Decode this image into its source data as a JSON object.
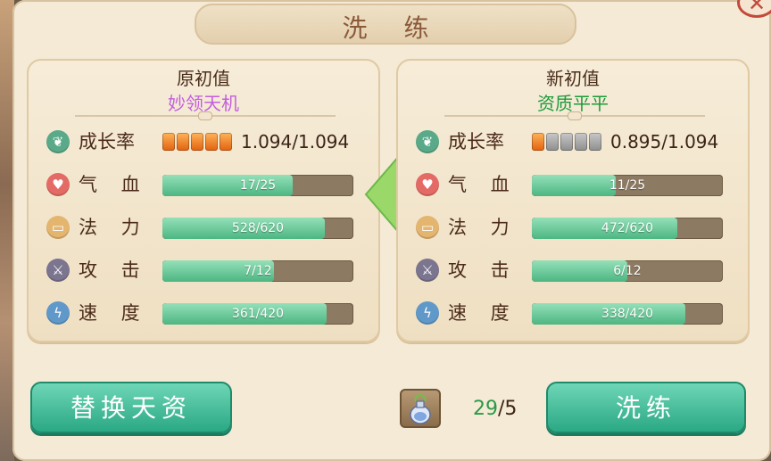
{
  "title": "洗 练",
  "close_label": "✕",
  "left_panel": {
    "heading": "原初值",
    "subtitle": "妙领天机",
    "growth": {
      "label": "成长率",
      "pips_on": 5,
      "pips_total": 5,
      "value": "1.094/1.094"
    },
    "stats": [
      {
        "label": "气 血",
        "text": "17/25",
        "fraction": 0.68
      },
      {
        "label": "法 力",
        "text": "528/620",
        "fraction": 0.8516
      },
      {
        "label": "攻 击",
        "text": "7/12",
        "fraction": 0.5833
      },
      {
        "label": "速 度",
        "text": "361/420",
        "fraction": 0.8595
      }
    ]
  },
  "right_panel": {
    "heading": "新初值",
    "subtitle": "资质平平",
    "growth": {
      "label": "成长率",
      "pips_on": 1,
      "pips_total": 5,
      "value": "0.895/1.094"
    },
    "stats": [
      {
        "label": "气 血",
        "text": "11/25",
        "fraction": 0.44
      },
      {
        "label": "法 力",
        "text": "472/620",
        "fraction": 0.7613
      },
      {
        "label": "攻 击",
        "text": "6/12",
        "fraction": 0.5
      },
      {
        "label": "速 度",
        "text": "338/420",
        "fraction": 0.8048
      }
    ]
  },
  "buttons": {
    "replace": "替换天资",
    "refine": "洗练"
  },
  "item": {
    "icon": "potion-vase-icon",
    "have": "29",
    "need": "/5"
  },
  "colors": {
    "accent_green": "#2aa884",
    "bar_fill": "#4cb682",
    "purple_quality": "#c35ee0",
    "green_quality": "#1d9a3c"
  }
}
